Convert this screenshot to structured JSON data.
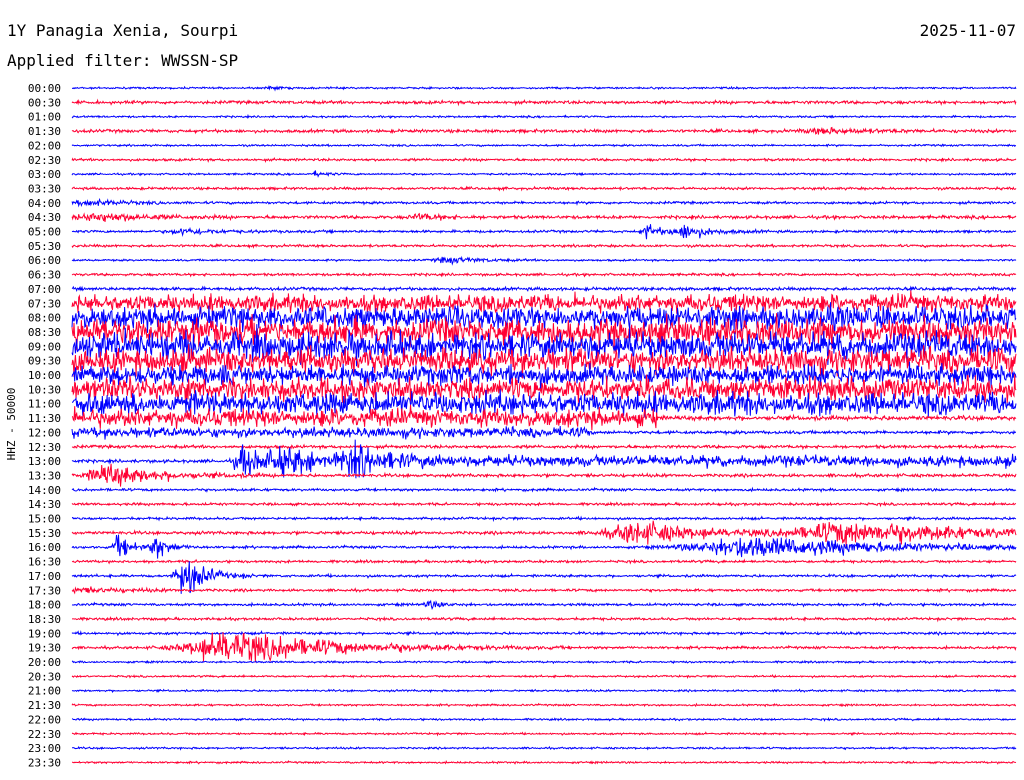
{
  "header": {
    "station": "1Y Panagia Xenia, Sourpi",
    "date": "2025-11-07",
    "filter": "Applied filter: WWSSN-SP"
  },
  "chart_data": {
    "type": "line",
    "title": "1Y Panagia Xenia, Sourpi",
    "subtitle": "Applied filter: WWSSN-SP",
    "ylabel": "HHZ - 50000",
    "colors": [
      "#0000ff",
      "#ff0033"
    ],
    "grid": false,
    "tick_labels": [
      "00:00",
      "00:30",
      "01:00",
      "01:30",
      "02:00",
      "02:30",
      "03:00",
      "03:30",
      "04:00",
      "04:30",
      "05:00",
      "05:30",
      "06:00",
      "06:30",
      "07:00",
      "07:30",
      "08:00",
      "08:30",
      "09:00",
      "09:30",
      "10:00",
      "10:30",
      "11:00",
      "11:30",
      "12:00",
      "12:30",
      "13:00",
      "13:30",
      "14:00",
      "14:30",
      "15:00",
      "15:30",
      "16:00",
      "16:30",
      "17:00",
      "17:30",
      "18:00",
      "18:30",
      "19:00",
      "19:30",
      "20:00",
      "20:30",
      "21:00",
      "21:30",
      "22:00",
      "22:30",
      "23:00",
      "23:30"
    ],
    "minutes_per_line": 30,
    "baseline_amplitude": [
      1.5,
      2.5,
      1.5,
      2.5,
      1.5,
      2.0,
      1.5,
      2.0,
      2.0,
      2.5,
      2.0,
      2.0,
      1.5,
      2.0,
      2.5,
      3.0,
      4.0,
      4.0,
      4.0,
      4.0,
      4.0,
      4.0,
      4.0,
      3.5,
      2.5,
      2.5,
      2.5,
      2.5,
      2.0,
      2.0,
      2.0,
      2.5,
      2.0,
      2.0,
      2.0,
      2.0,
      2.0,
      2.0,
      2.0,
      2.0,
      1.5,
      1.5,
      1.5,
      1.5,
      1.5,
      1.5,
      1.5,
      1.5
    ],
    "noise_bands": [
      {
        "line": 15,
        "x": [
          0.0,
          1.0
        ],
        "amplitude": 14
      },
      {
        "line": 16,
        "x": [
          0.0,
          1.0
        ],
        "amplitude": 18
      },
      {
        "line": 17,
        "x": [
          0.0,
          1.0
        ],
        "amplitude": 22
      },
      {
        "line": 18,
        "x": [
          0.0,
          1.0
        ],
        "amplitude": 22
      },
      {
        "line": 19,
        "x": [
          0.0,
          1.0
        ],
        "amplitude": 20
      },
      {
        "line": 20,
        "x": [
          0.0,
          1.0
        ],
        "amplitude": 16
      },
      {
        "line": 21,
        "x": [
          0.0,
          1.0
        ],
        "amplitude": 18
      },
      {
        "line": 22,
        "x": [
          0.0,
          1.0
        ],
        "amplitude": 18
      },
      {
        "line": 23,
        "x": [
          0.0,
          0.62
        ],
        "amplitude": 14
      },
      {
        "line": 24,
        "x": [
          0.0,
          0.55
        ],
        "amplitude": 7
      },
      {
        "line": 26,
        "x": [
          0.18,
          1.0
        ],
        "amplitude": 8
      }
    ],
    "events": [
      {
        "line": 0,
        "x": 0.21,
        "amplitude": 4,
        "width": 0.004
      },
      {
        "line": 3,
        "x": 0.8,
        "amplitude": 4,
        "width": 0.03
      },
      {
        "line": 6,
        "x": 0.26,
        "amplitude": 4,
        "width": 0.006
      },
      {
        "line": 8,
        "x": 0.02,
        "amplitude": 5,
        "width": 0.02
      },
      {
        "line": 9,
        "x": 0.03,
        "amplitude": 7,
        "width": 0.03
      },
      {
        "line": 9,
        "x": 0.37,
        "amplitude": 5,
        "width": 0.015
      },
      {
        "line": 10,
        "x": 0.12,
        "amplitude": 5,
        "width": 0.02
      },
      {
        "line": 10,
        "x": 0.61,
        "amplitude": 12,
        "width": 0.008
      },
      {
        "line": 10,
        "x": 0.65,
        "amplitude": 12,
        "width": 0.015
      },
      {
        "line": 12,
        "x": 0.4,
        "amplitude": 5,
        "width": 0.02
      },
      {
        "line": 26,
        "x": 0.18,
        "amplitude": 28,
        "width": 0.01
      },
      {
        "line": 26,
        "x": 0.23,
        "amplitude": 16,
        "width": 0.02
      },
      {
        "line": 26,
        "x": 0.3,
        "amplitude": 22,
        "width": 0.02
      },
      {
        "line": 27,
        "x": 0.04,
        "amplitude": 18,
        "width": 0.03
      },
      {
        "line": 31,
        "x": 0.6,
        "amplitude": 18,
        "width": 0.04
      },
      {
        "line": 31,
        "x": 0.83,
        "amplitude": 18,
        "width": 0.08
      },
      {
        "line": 32,
        "x": 0.05,
        "amplitude": 20,
        "width": 0.008
      },
      {
        "line": 32,
        "x": 0.09,
        "amplitude": 18,
        "width": 0.008
      },
      {
        "line": 32,
        "x": 0.72,
        "amplitude": 18,
        "width": 0.08
      },
      {
        "line": 34,
        "x": 0.12,
        "amplitude": 36,
        "width": 0.012
      },
      {
        "line": 35,
        "x": 0.01,
        "amplitude": 4,
        "width": 0.03
      },
      {
        "line": 36,
        "x": 0.38,
        "amplitude": 5,
        "width": 0.01
      },
      {
        "line": 39,
        "x": 0.17,
        "amplitude": 28,
        "width": 0.06
      }
    ]
  }
}
